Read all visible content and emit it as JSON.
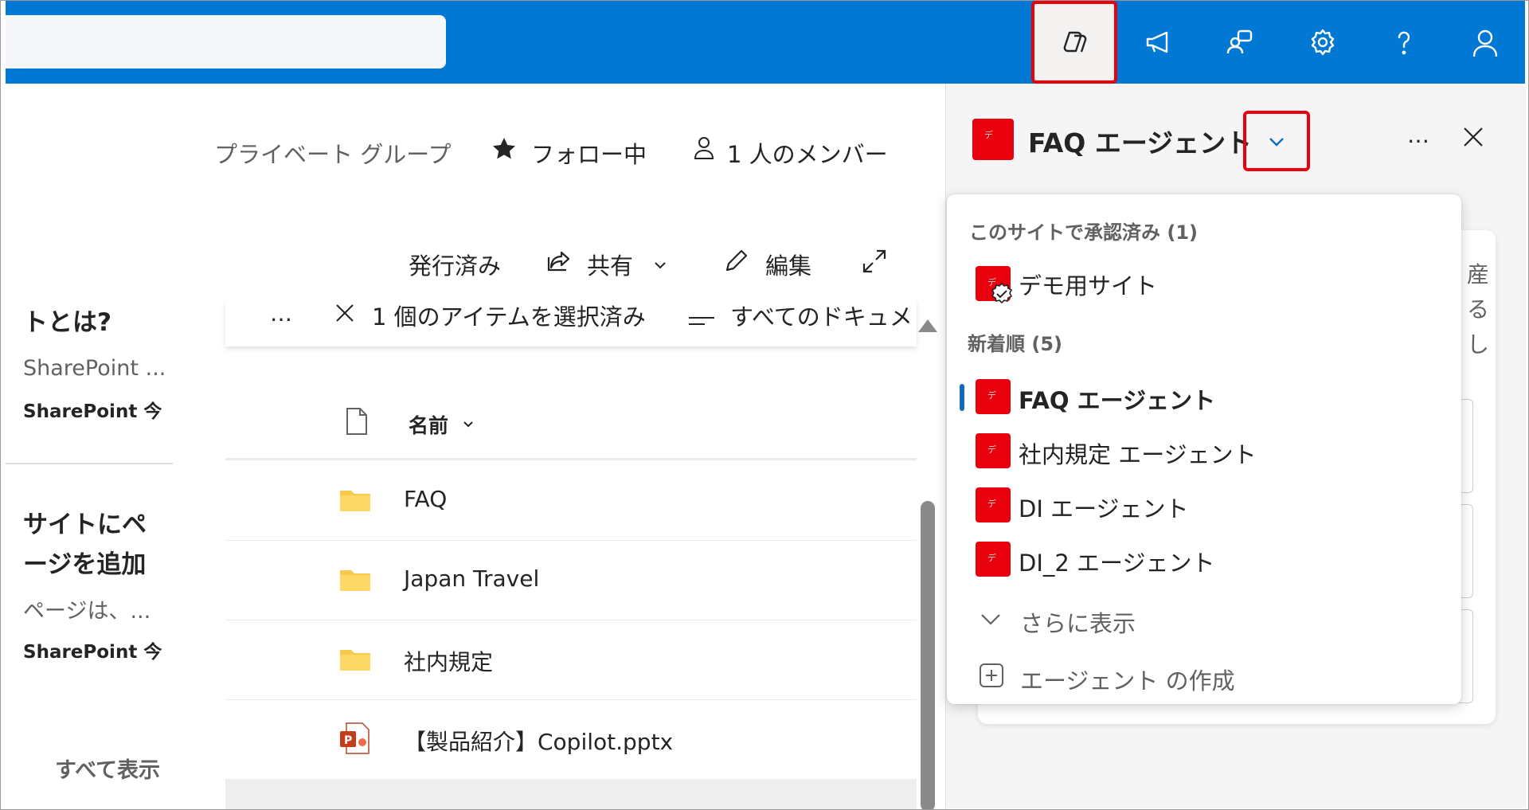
{
  "header": {
    "group_type": "プライベート グループ",
    "follow_label": "フォロー中",
    "members_label": "1 人のメンバー"
  },
  "toolbar": {
    "published": "発行済み",
    "share": "共有",
    "edit": "編集"
  },
  "selection_bar": {
    "more": "…",
    "selected_label": "1 個のアイテムを選択済み",
    "view_label": "すべてのドキュメ"
  },
  "news_cards": [
    {
      "title": "トとは?",
      "desc": "SharePoint ...",
      "meta": "SharePoint 今"
    },
    {
      "title_line1": "サイトにペ",
      "title_line2": "ージを追加",
      "desc": "ページは、...",
      "meta": "SharePoint 今"
    }
  ],
  "see_all": "すべて表示",
  "file_list": {
    "column_name": "名前",
    "rows": [
      {
        "name": "FAQ",
        "type": "folder"
      },
      {
        "name": "Japan Travel",
        "type": "folder"
      },
      {
        "name": "社内規定",
        "type": "folder"
      },
      {
        "name": "【製品紹介】Copilot.pptx",
        "type": "pptx"
      }
    ]
  },
  "panel": {
    "title": "FAQ エージェント",
    "more": "…",
    "bg_fragment_1": "産",
    "bg_fragment_2": "る",
    "bg_fragment_3": "し"
  },
  "dropdown": {
    "approved_header": "このサイトで承認済み (1)",
    "approved_items": [
      {
        "label": "デモ用サイト"
      }
    ],
    "recent_header": "新着順 (5)",
    "recent_items": [
      {
        "label": "FAQ エージェント",
        "selected": true
      },
      {
        "label": "社内規定 エージェント"
      },
      {
        "label": "DI エージェント"
      },
      {
        "label": "DI_2 エージェント"
      }
    ],
    "show_more": "さらに表示",
    "create": "エージェント の作成"
  },
  "colors": {
    "brand_blue": "#0078d4",
    "highlight_red": "#e8000d",
    "agent_red": "#e8000d",
    "selected_indicator": "#0f6cbd",
    "folder_yellow": "#f7c948"
  }
}
